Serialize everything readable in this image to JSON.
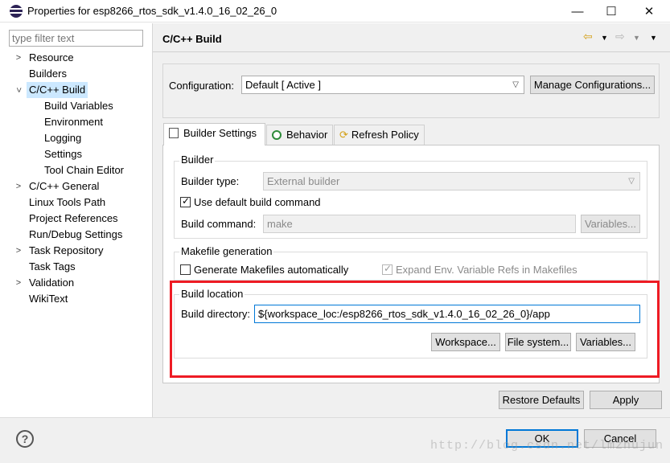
{
  "window": {
    "title": "Properties for esp8266_rtos_sdk_v1.4.0_16_02_26_0",
    "minimize": "—",
    "maximize": "☐",
    "close": "✕"
  },
  "sidebar": {
    "filter_placeholder": "type filter text",
    "items": [
      {
        "label": "Resource",
        "expandable": true
      },
      {
        "label": "Builders",
        "expandable": false
      },
      {
        "label": "C/C++ Build",
        "expandable": true,
        "expanded": true,
        "selected": true
      },
      {
        "label": "Build Variables"
      },
      {
        "label": "Environment"
      },
      {
        "label": "Logging"
      },
      {
        "label": "Settings"
      },
      {
        "label": "Tool Chain Editor"
      },
      {
        "label": "C/C++ General",
        "expandable": true
      },
      {
        "label": "Linux Tools Path"
      },
      {
        "label": "Project References"
      },
      {
        "label": "Run/Debug Settings"
      },
      {
        "label": "Task Repository",
        "expandable": true
      },
      {
        "label": "Task Tags"
      },
      {
        "label": "Validation",
        "expandable": true
      },
      {
        "label": "WikiText"
      }
    ]
  },
  "page": {
    "title": "C/C++ Build",
    "configuration_label": "Configuration:",
    "configuration_value": "Default  [ Active ]",
    "manage_configurations": "Manage Configurations..."
  },
  "tabs": [
    {
      "label": "Builder Settings",
      "active": true
    },
    {
      "label": "Behavior"
    },
    {
      "label": "Refresh Policy"
    }
  ],
  "builder": {
    "group_label": "Builder",
    "type_label": "Builder type:",
    "type_value": "External builder",
    "use_default_label": "Use default build command",
    "use_default_checked": true,
    "command_label": "Build command:",
    "command_value": "make",
    "variables_button": "Variables..."
  },
  "makefile": {
    "group_label": "Makefile generation",
    "generate_label": "Generate Makefiles automatically",
    "generate_checked": false,
    "expand_env_label": "Expand Env. Variable Refs in Makefiles",
    "expand_env_checked": true
  },
  "build_location": {
    "group_label": "Build location",
    "directory_label": "Build directory:",
    "directory_value": "${workspace_loc:/esp8266_rtos_sdk_v1.4.0_16_02_26_0}/app",
    "workspace_button": "Workspace...",
    "filesystem_button": "File system...",
    "variables_button": "Variables..."
  },
  "actions": {
    "restore_defaults": "Restore Defaults",
    "apply": "Apply",
    "ok": "OK",
    "cancel": "Cancel"
  },
  "help_icon": "?",
  "watermark": "http://blog.csdn.net/lmzhujun",
  "colors": {
    "highlight_box": "#ee1b24",
    "selection": "#cce8ff",
    "focus_border": "#0078d7"
  }
}
